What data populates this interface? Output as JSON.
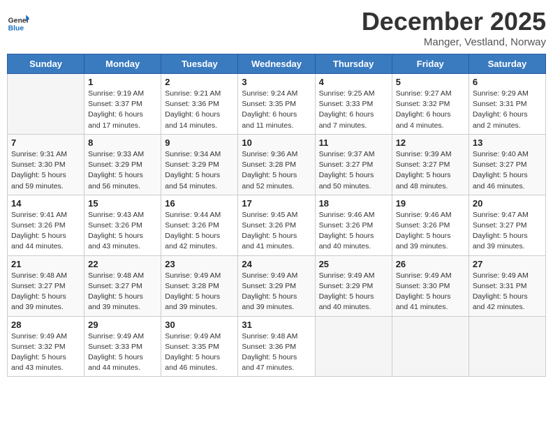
{
  "header": {
    "logo_line1": "General",
    "logo_line2": "Blue",
    "title": "December 2025",
    "subtitle": "Manger, Vestland, Norway"
  },
  "days_of_week": [
    "Sunday",
    "Monday",
    "Tuesday",
    "Wednesday",
    "Thursday",
    "Friday",
    "Saturday"
  ],
  "weeks": [
    [
      {
        "num": "",
        "info": ""
      },
      {
        "num": "1",
        "info": "Sunrise: 9:19 AM\nSunset: 3:37 PM\nDaylight: 6 hours\nand 17 minutes."
      },
      {
        "num": "2",
        "info": "Sunrise: 9:21 AM\nSunset: 3:36 PM\nDaylight: 6 hours\nand 14 minutes."
      },
      {
        "num": "3",
        "info": "Sunrise: 9:24 AM\nSunset: 3:35 PM\nDaylight: 6 hours\nand 11 minutes."
      },
      {
        "num": "4",
        "info": "Sunrise: 9:25 AM\nSunset: 3:33 PM\nDaylight: 6 hours\nand 7 minutes."
      },
      {
        "num": "5",
        "info": "Sunrise: 9:27 AM\nSunset: 3:32 PM\nDaylight: 6 hours\nand 4 minutes."
      },
      {
        "num": "6",
        "info": "Sunrise: 9:29 AM\nSunset: 3:31 PM\nDaylight: 6 hours\nand 2 minutes."
      }
    ],
    [
      {
        "num": "7",
        "info": "Sunrise: 9:31 AM\nSunset: 3:30 PM\nDaylight: 5 hours\nand 59 minutes."
      },
      {
        "num": "8",
        "info": "Sunrise: 9:33 AM\nSunset: 3:29 PM\nDaylight: 5 hours\nand 56 minutes."
      },
      {
        "num": "9",
        "info": "Sunrise: 9:34 AM\nSunset: 3:29 PM\nDaylight: 5 hours\nand 54 minutes."
      },
      {
        "num": "10",
        "info": "Sunrise: 9:36 AM\nSunset: 3:28 PM\nDaylight: 5 hours\nand 52 minutes."
      },
      {
        "num": "11",
        "info": "Sunrise: 9:37 AM\nSunset: 3:27 PM\nDaylight: 5 hours\nand 50 minutes."
      },
      {
        "num": "12",
        "info": "Sunrise: 9:39 AM\nSunset: 3:27 PM\nDaylight: 5 hours\nand 48 minutes."
      },
      {
        "num": "13",
        "info": "Sunrise: 9:40 AM\nSunset: 3:27 PM\nDaylight: 5 hours\nand 46 minutes."
      }
    ],
    [
      {
        "num": "14",
        "info": "Sunrise: 9:41 AM\nSunset: 3:26 PM\nDaylight: 5 hours\nand 44 minutes."
      },
      {
        "num": "15",
        "info": "Sunrise: 9:43 AM\nSunset: 3:26 PM\nDaylight: 5 hours\nand 43 minutes."
      },
      {
        "num": "16",
        "info": "Sunrise: 9:44 AM\nSunset: 3:26 PM\nDaylight: 5 hours\nand 42 minutes."
      },
      {
        "num": "17",
        "info": "Sunrise: 9:45 AM\nSunset: 3:26 PM\nDaylight: 5 hours\nand 41 minutes."
      },
      {
        "num": "18",
        "info": "Sunrise: 9:46 AM\nSunset: 3:26 PM\nDaylight: 5 hours\nand 40 minutes."
      },
      {
        "num": "19",
        "info": "Sunrise: 9:46 AM\nSunset: 3:26 PM\nDaylight: 5 hours\nand 39 minutes."
      },
      {
        "num": "20",
        "info": "Sunrise: 9:47 AM\nSunset: 3:27 PM\nDaylight: 5 hours\nand 39 minutes."
      }
    ],
    [
      {
        "num": "21",
        "info": "Sunrise: 9:48 AM\nSunset: 3:27 PM\nDaylight: 5 hours\nand 39 minutes."
      },
      {
        "num": "22",
        "info": "Sunrise: 9:48 AM\nSunset: 3:27 PM\nDaylight: 5 hours\nand 39 minutes."
      },
      {
        "num": "23",
        "info": "Sunrise: 9:49 AM\nSunset: 3:28 PM\nDaylight: 5 hours\nand 39 minutes."
      },
      {
        "num": "24",
        "info": "Sunrise: 9:49 AM\nSunset: 3:29 PM\nDaylight: 5 hours\nand 39 minutes."
      },
      {
        "num": "25",
        "info": "Sunrise: 9:49 AM\nSunset: 3:29 PM\nDaylight: 5 hours\nand 40 minutes."
      },
      {
        "num": "26",
        "info": "Sunrise: 9:49 AM\nSunset: 3:30 PM\nDaylight: 5 hours\nand 41 minutes."
      },
      {
        "num": "27",
        "info": "Sunrise: 9:49 AM\nSunset: 3:31 PM\nDaylight: 5 hours\nand 42 minutes."
      }
    ],
    [
      {
        "num": "28",
        "info": "Sunrise: 9:49 AM\nSunset: 3:32 PM\nDaylight: 5 hours\nand 43 minutes."
      },
      {
        "num": "29",
        "info": "Sunrise: 9:49 AM\nSunset: 3:33 PM\nDaylight: 5 hours\nand 44 minutes."
      },
      {
        "num": "30",
        "info": "Sunrise: 9:49 AM\nSunset: 3:35 PM\nDaylight: 5 hours\nand 46 minutes."
      },
      {
        "num": "31",
        "info": "Sunrise: 9:48 AM\nSunset: 3:36 PM\nDaylight: 5 hours\nand 47 minutes."
      },
      {
        "num": "",
        "info": ""
      },
      {
        "num": "",
        "info": ""
      },
      {
        "num": "",
        "info": ""
      }
    ]
  ]
}
